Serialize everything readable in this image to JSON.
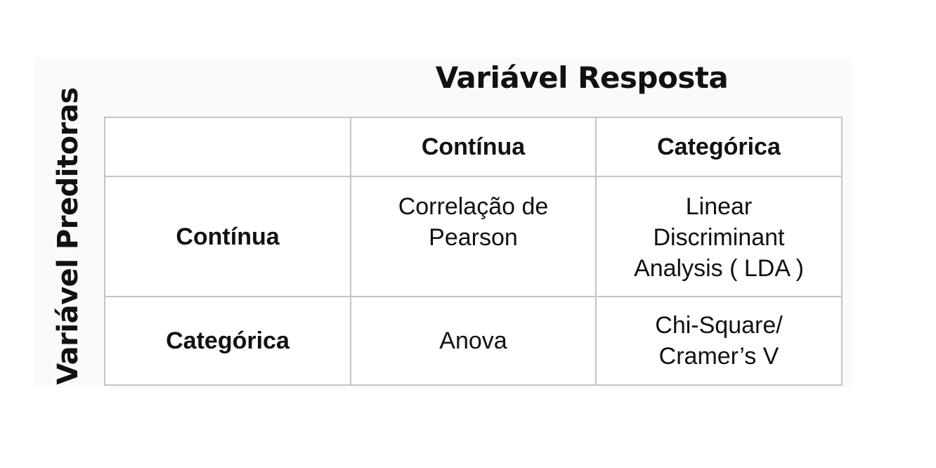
{
  "column_axis_title": "Variável Resposta",
  "row_axis_title": "Variável Preditoras",
  "columns": [
    "",
    "Contínua",
    "Categórica"
  ],
  "rows": [
    {
      "label": "Contínua",
      "cells": [
        [
          "Correlação de",
          "Pearson"
        ],
        [
          "Linear",
          "Discriminant",
          "Analysis ( LDA )"
        ]
      ]
    },
    {
      "label": "Categórica",
      "cells": [
        [
          "Anova"
        ],
        [
          "Chi-Square/",
          "Cramer’s V"
        ]
      ]
    }
  ],
  "colors": {
    "grid_line": "#c4c4c4",
    "text": "#111111",
    "panel_background": "#fafafa"
  }
}
